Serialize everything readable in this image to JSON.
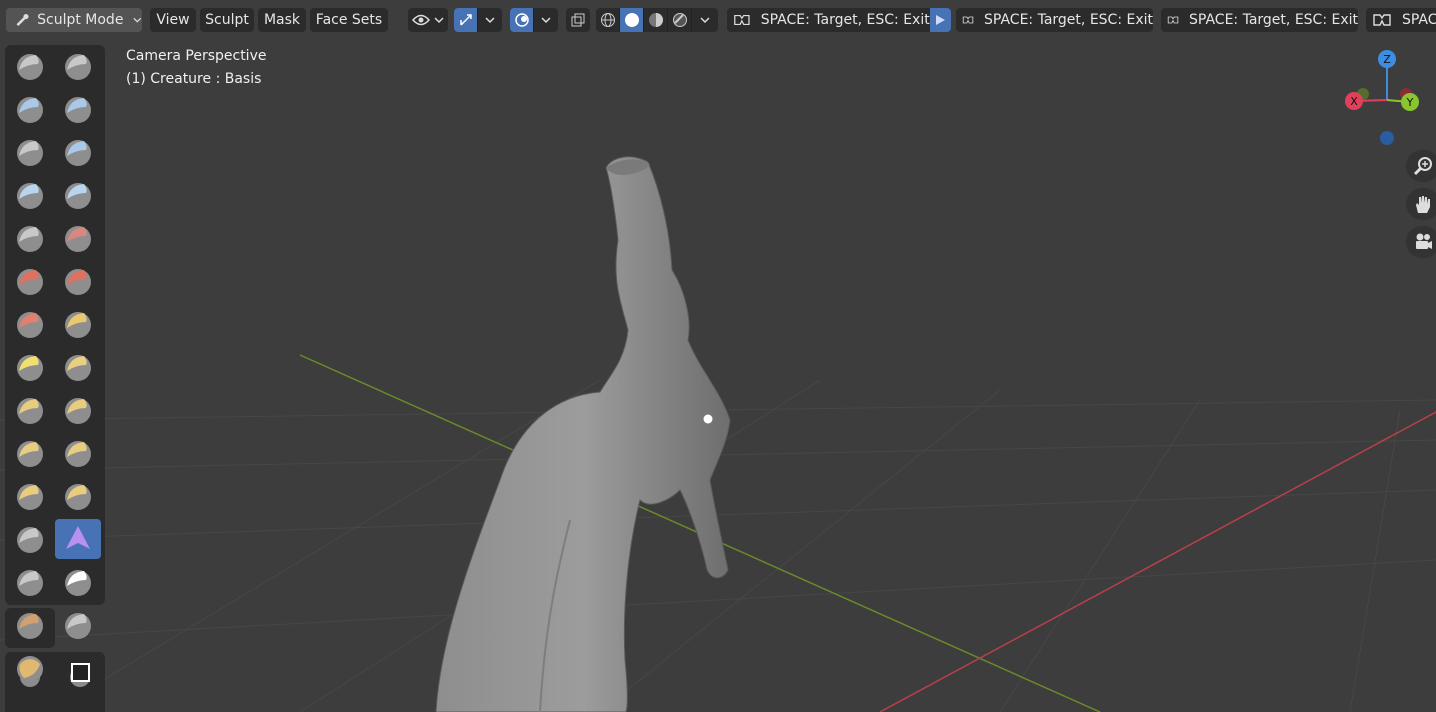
{
  "header": {
    "mode_label": "Sculpt Mode",
    "menus": [
      "View",
      "Sculpt",
      "Mask",
      "Face Sets"
    ],
    "walk_buttons": [
      "SPACE: Target, ESC: Exit",
      "SPACE: Target, ESC: Exit",
      "SPACE: Target, ESC: Exit",
      "SPACE: Target, ESC: Exit"
    ]
  },
  "viewport": {
    "perspective": "Camera Perspective",
    "object": "(1) Creature : Basis",
    "gizmo": {
      "x": "X",
      "y": "Y",
      "z": "Z"
    }
  },
  "colors": {
    "viewport_bg": "#3d3d3d",
    "active_tool": "#4772b3",
    "x_axis": "#e0405a",
    "y_axis": "#8ac52f",
    "z_axis": "#3d8de0"
  },
  "tools": [
    "draw-brush-icon",
    "draw-sharp-brush-icon",
    "clay-brush-icon",
    "clay-strips-brush-icon",
    "clay-thumb-brush-icon",
    "layer-brush-icon",
    "inflate-brush-icon",
    "blob-brush-icon",
    "crease-brush-icon",
    "smooth-brush-icon",
    "flatten-brush-icon",
    "fill-brush-icon",
    "scrape-brush-icon",
    "multiplane-scrape-brush-icon",
    "pinch-brush-icon",
    "grab-brush-icon",
    "elastic-deform-brush-icon",
    "snake-hook-brush-icon",
    "thumb-brush-icon",
    "pose-brush-icon",
    "nudge-brush-icon",
    "rotate-brush-icon",
    "slide-relax-brush-icon",
    "boundary-brush-icon",
    "cloth-brush-icon",
    "simplify-brush-icon",
    "mask-brush-icon",
    "draw-face-sets-brush-icon",
    "multires-displacement-eraser-icon"
  ]
}
